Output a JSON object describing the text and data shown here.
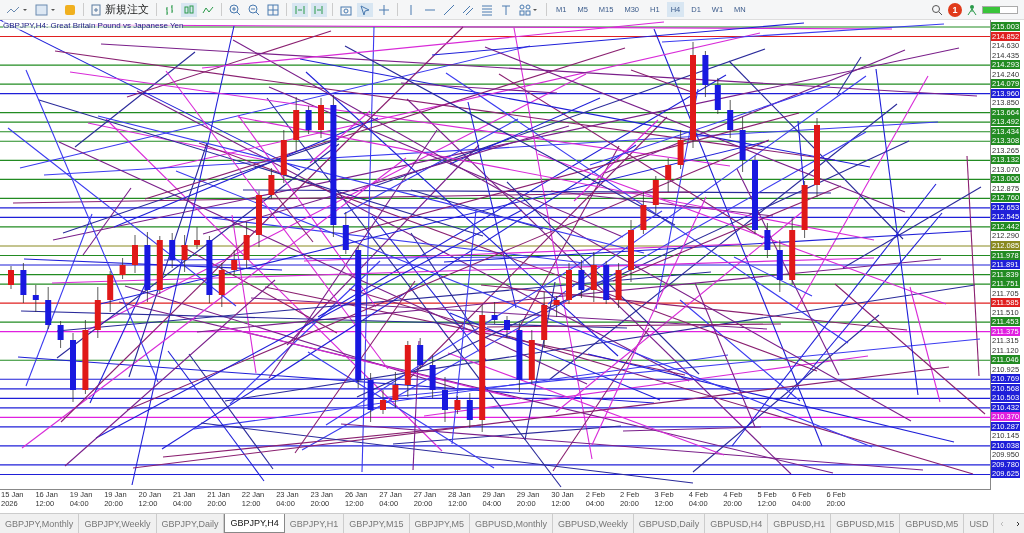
{
  "toolbar": {
    "new_order": "新規注文",
    "timeframes": [
      {
        "label": "M1",
        "selected": false
      },
      {
        "label": "M5",
        "selected": false
      },
      {
        "label": "M15",
        "selected": false
      },
      {
        "label": "M30",
        "selected": false
      },
      {
        "label": "H1",
        "selected": false
      },
      {
        "label": "H4",
        "selected": true
      },
      {
        "label": "D1",
        "selected": false
      },
      {
        "label": "W1",
        "selected": false
      },
      {
        "label": "MN",
        "selected": false
      }
    ],
    "notification_count": "1"
  },
  "chart": {
    "title": "GBPJPY,H4: Great Britain Pound vs Japanese Yen",
    "price_labels": [
      {
        "text": "215.003",
        "kind": "badge",
        "color": "#228b22"
      },
      {
        "text": "214.852",
        "kind": "badge",
        "color": "#e02020"
      },
      {
        "text": "214.630",
        "kind": "tick"
      },
      {
        "text": "214.435",
        "kind": "tick"
      },
      {
        "text": "214.293",
        "kind": "badge",
        "color": "#228b22"
      },
      {
        "text": "214.240",
        "kind": "tick"
      },
      {
        "text": "214.079",
        "kind": "badge",
        "color": "#228b22"
      },
      {
        "text": "213.960",
        "kind": "badge",
        "color": "#1f1fd8"
      },
      {
        "text": "213.850",
        "kind": "tick"
      },
      {
        "text": "213.664",
        "kind": "badge",
        "color": "#228b22"
      },
      {
        "text": "213.492",
        "kind": "badge",
        "color": "#228b22"
      },
      {
        "text": "213.434",
        "kind": "badge",
        "color": "#228b22"
      },
      {
        "text": "213.308",
        "kind": "badge",
        "color": "#228b22"
      },
      {
        "text": "213.265",
        "kind": "tick"
      },
      {
        "text": "213.132",
        "kind": "badge",
        "color": "#228b22"
      },
      {
        "text": "213.070",
        "kind": "tick"
      },
      {
        "text": "213.006",
        "kind": "badge",
        "color": "#228b22"
      },
      {
        "text": "212.875",
        "kind": "tick"
      },
      {
        "text": "212.760",
        "kind": "badge",
        "color": "#228b22"
      },
      {
        "text": "212.653",
        "kind": "badge",
        "color": "#1f1fd8"
      },
      {
        "text": "212.545",
        "kind": "badge",
        "color": "#1f1fd8"
      },
      {
        "text": "212.442",
        "kind": "badge",
        "color": "#228b22"
      },
      {
        "text": "212.290",
        "kind": "tick"
      },
      {
        "text": "212.085",
        "kind": "badge",
        "color": "#8a8a20"
      },
      {
        "text": "211.978",
        "kind": "badge",
        "color": "#228b22"
      },
      {
        "text": "211.891",
        "kind": "badge",
        "color": "#1f1fd8"
      },
      {
        "text": "211.839",
        "kind": "badge",
        "color": "#228b22"
      },
      {
        "text": "211.751",
        "kind": "badge",
        "color": "#228b22"
      },
      {
        "text": "211.705",
        "kind": "tick"
      },
      {
        "text": "211.585",
        "kind": "badge",
        "color": "#e02020"
      },
      {
        "text": "211.510",
        "kind": "tick"
      },
      {
        "text": "211.453",
        "kind": "badge",
        "color": "#228b22"
      },
      {
        "text": "211.375",
        "kind": "badge",
        "color": "#e020e0"
      },
      {
        "text": "211.315",
        "kind": "tick"
      },
      {
        "text": "211.120",
        "kind": "tick"
      },
      {
        "text": "211.046",
        "kind": "badge",
        "color": "#228b22"
      },
      {
        "text": "210.925",
        "kind": "tick"
      },
      {
        "text": "210.769",
        "kind": "badge",
        "color": "#1f1fd8"
      },
      {
        "text": "210.568",
        "kind": "badge",
        "color": "#1f1fd8"
      },
      {
        "text": "210.503",
        "kind": "badge",
        "color": "#1f1fd8"
      },
      {
        "text": "210.432",
        "kind": "badge",
        "color": "#1f1fd8"
      },
      {
        "text": "210.370",
        "kind": "badge",
        "color": "#e020e0"
      },
      {
        "text": "210.287",
        "kind": "badge",
        "color": "#1f1fd8"
      },
      {
        "text": "210.145",
        "kind": "tick"
      },
      {
        "text": "210.038",
        "kind": "badge",
        "color": "#1f1fd8"
      },
      {
        "text": "209.950",
        "kind": "tick"
      },
      {
        "text": "209.780",
        "kind": "badge",
        "color": "#1f1fd8"
      },
      {
        "text": "209.625",
        "kind": "badge",
        "color": "#1f1fd8"
      }
    ],
    "time_labels": [
      "15 Jan 2026",
      "16 Jan 12:00",
      "19 Jan 04:00",
      "19 Jan 20:00",
      "20 Jan 12:00",
      "21 Jan 04:00",
      "21 Jan 20:00",
      "22 Jan 12:00",
      "23 Jan 04:00",
      "23 Jan 20:00",
      "26 Jan 12:00",
      "27 Jan 04:00",
      "27 Jan 20:00",
      "28 Jan 12:00",
      "29 Jan 04:00",
      "29 Jan 20:00",
      "30 Jan 12:00",
      "2 Feb 04:00",
      "2 Feb 20:00",
      "3 Feb 12:00",
      "4 Feb 04:00",
      "4 Feb 20:00",
      "5 Feb 12:00",
      "6 Feb 04:00",
      "6 Feb 20:00"
    ]
  },
  "tabs": [
    {
      "label": "GBPJPY,Monthly",
      "selected": false
    },
    {
      "label": "GBPJPY,Weekly",
      "selected": false
    },
    {
      "label": "GBPJPY,Daily",
      "selected": false
    },
    {
      "label": "GBPJPY,H4",
      "selected": true
    },
    {
      "label": "GBPJPY,H1",
      "selected": false
    },
    {
      "label": "GBPJPY,M15",
      "selected": false
    },
    {
      "label": "GBPJPY,M5",
      "selected": false
    },
    {
      "label": "GBPUSD,Monthly",
      "selected": false
    },
    {
      "label": "GBPUSD,Weekly",
      "selected": false
    },
    {
      "label": "GBPUSD,Daily",
      "selected": false
    },
    {
      "label": "GBPUSD,H4",
      "selected": false
    },
    {
      "label": "GBPUSD,H1",
      "selected": false
    },
    {
      "label": "GBPUSD,M15",
      "selected": false
    },
    {
      "label": "GBPUSD,M5",
      "selected": false
    },
    {
      "label": "USD",
      "selected": false
    }
  ]
}
